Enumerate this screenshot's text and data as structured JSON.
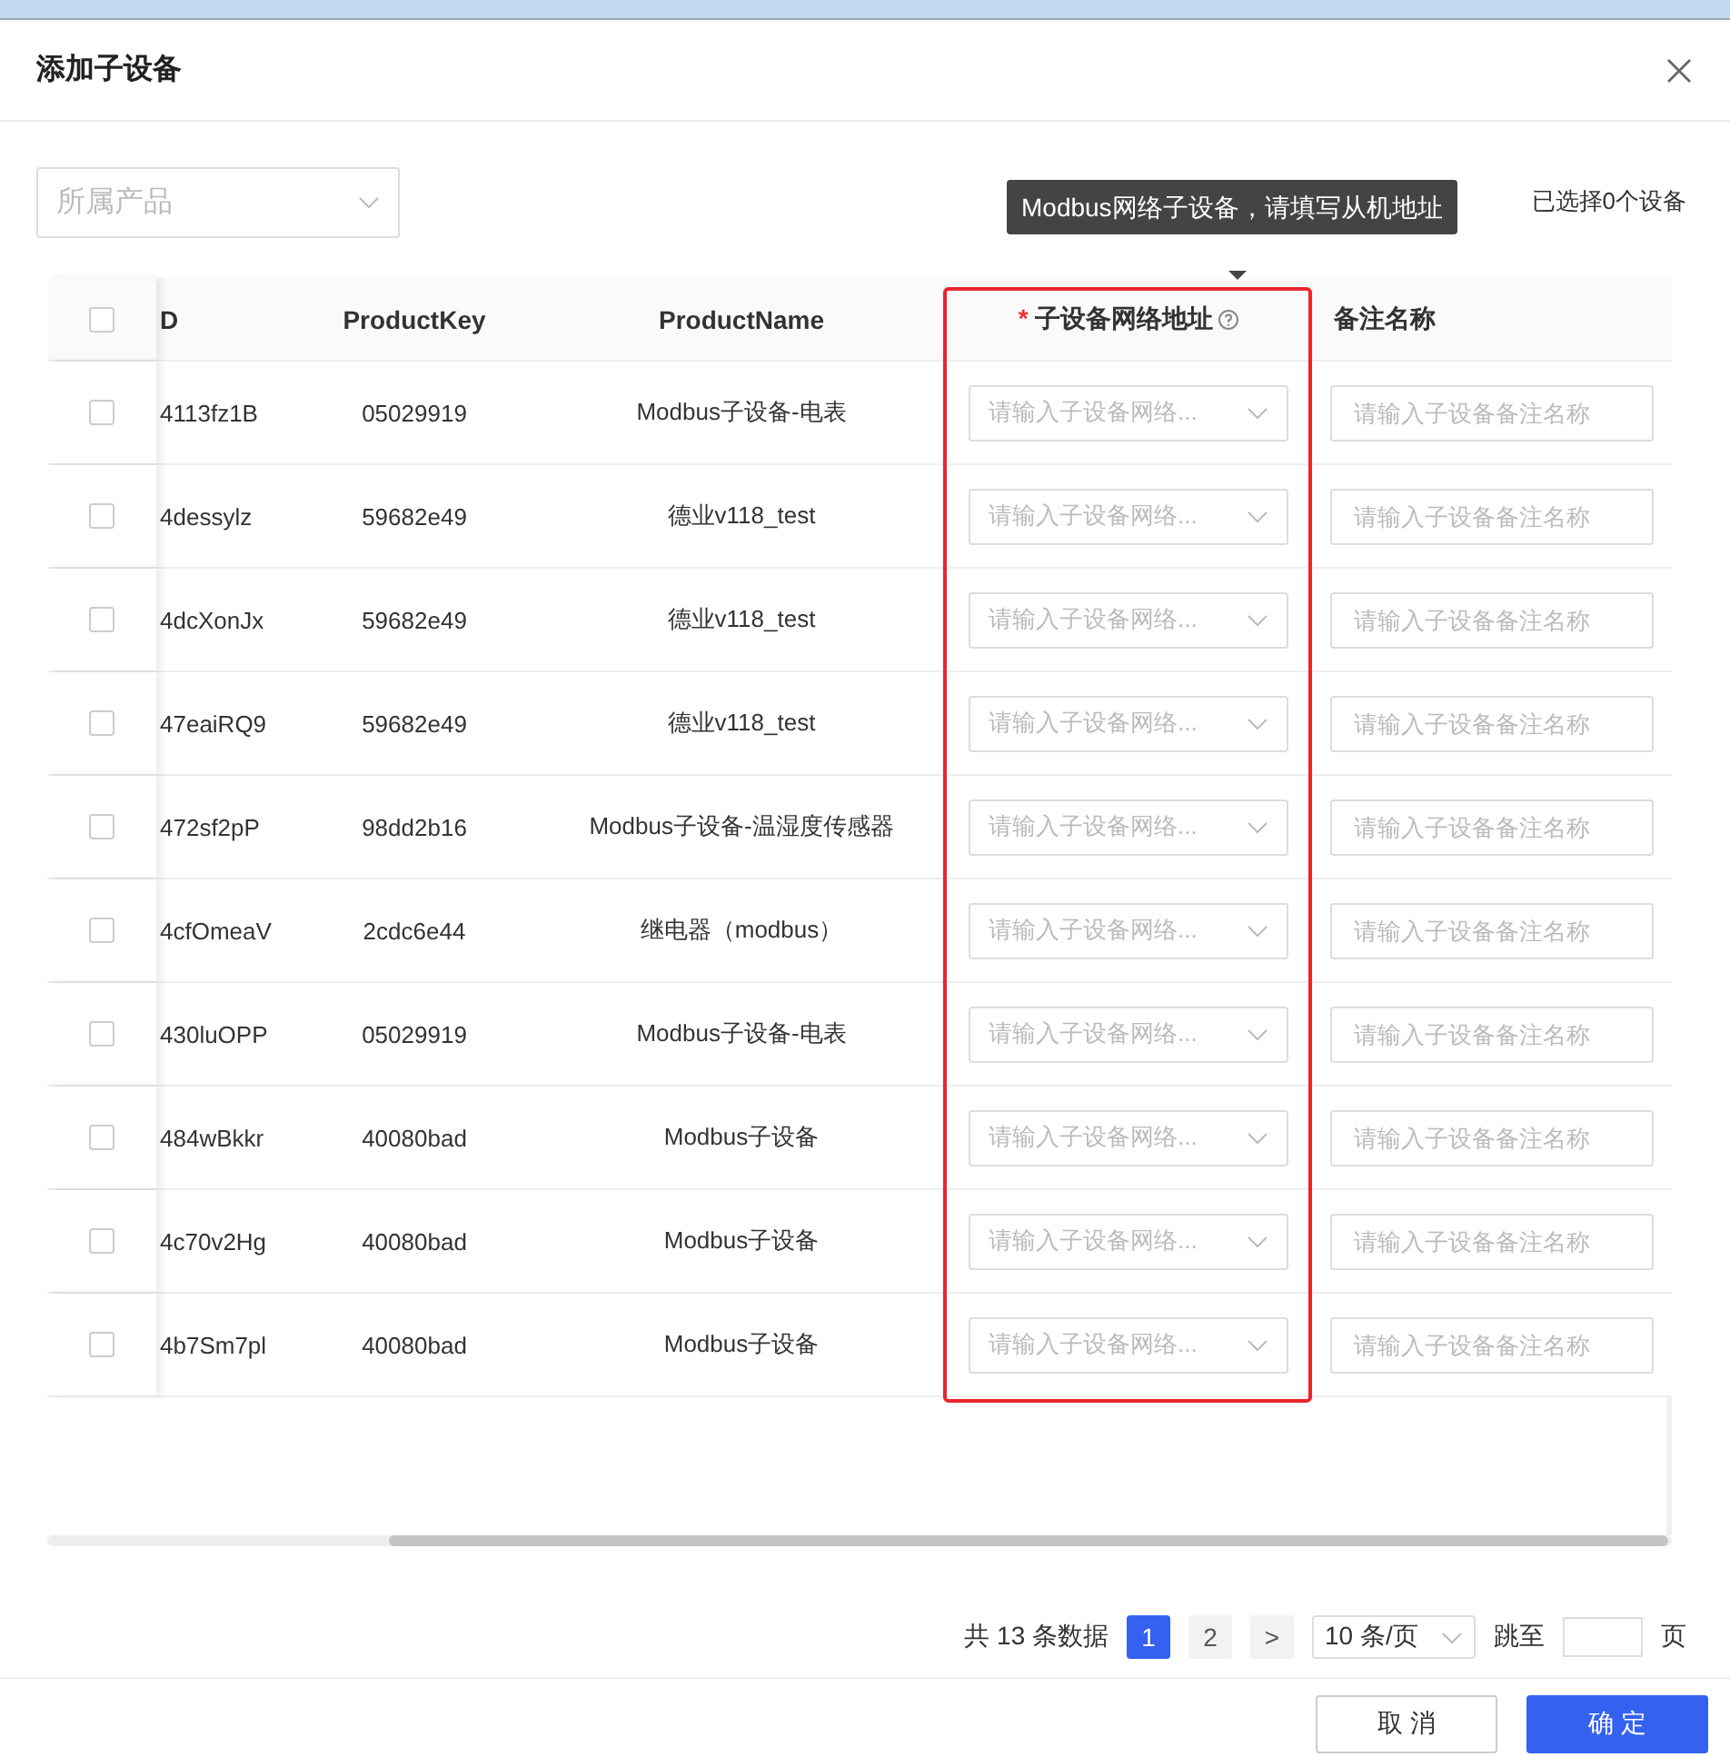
{
  "dialog": {
    "title": "添加子设备"
  },
  "filter": {
    "placeholder": "所属产品"
  },
  "selected_count": "已选择0个设备",
  "tooltip": "Modbus网络子设备，请填写从机地址",
  "table": {
    "columns": [
      {
        "label": "D",
        "kind": "text"
      },
      {
        "label": "ProductKey",
        "kind": "text"
      },
      {
        "label": "ProductName",
        "kind": "text"
      },
      {
        "label": "子设备网络地址",
        "kind": "address",
        "required_mark": "*"
      },
      {
        "label": "备注名称",
        "kind": "remark"
      }
    ],
    "header_checked": false,
    "rows": [
      {
        "checked": false,
        "id": "4113fz1B",
        "product_key": "05029919",
        "product_name": "Modbus子设备-电表",
        "address_placeholder": "请输入子设备网络...",
        "remark_placeholder": "请输入子设备备注名称"
      },
      {
        "checked": false,
        "id": "4dessylz",
        "product_key": "59682e49",
        "product_name": "德业v118_test",
        "address_placeholder": "请输入子设备网络...",
        "remark_placeholder": "请输入子设备备注名称"
      },
      {
        "checked": false,
        "id": "4dcXonJx",
        "product_key": "59682e49",
        "product_name": "德业v118_test",
        "address_placeholder": "请输入子设备网络...",
        "remark_placeholder": "请输入子设备备注名称"
      },
      {
        "checked": false,
        "id": "47eaiRQ9",
        "product_key": "59682e49",
        "product_name": "德业v118_test",
        "address_placeholder": "请输入子设备网络...",
        "remark_placeholder": "请输入子设备备注名称"
      },
      {
        "checked": false,
        "id": "472sf2pP",
        "product_key": "98dd2b16",
        "product_name": "Modbus子设备-温湿度传感器",
        "address_placeholder": "请输入子设备网络...",
        "remark_placeholder": "请输入子设备备注名称"
      },
      {
        "checked": false,
        "id": "4cfOmeaV",
        "product_key": "2cdc6e44",
        "product_name": "继电器（modbus）",
        "address_placeholder": "请输入子设备网络...",
        "remark_placeholder": "请输入子设备备注名称"
      },
      {
        "checked": false,
        "id": "430luOPP",
        "product_key": "05029919",
        "product_name": "Modbus子设备-电表",
        "address_placeholder": "请输入子设备网络...",
        "remark_placeholder": "请输入子设备备注名称"
      },
      {
        "checked": false,
        "id": "484wBkkr",
        "product_key": "40080bad",
        "product_name": "Modbus子设备",
        "address_placeholder": "请输入子设备网络...",
        "remark_placeholder": "请输入子设备备注名称"
      },
      {
        "checked": false,
        "id": "4c70v2Hg",
        "product_key": "40080bad",
        "product_name": "Modbus子设备",
        "address_placeholder": "请输入子设备网络...",
        "remark_placeholder": "请输入子设备备注名称"
      },
      {
        "checked": false,
        "id": "4b7Sm7pl",
        "product_key": "40080bad",
        "product_name": "Modbus子设备",
        "address_placeholder": "请输入子设备网络...",
        "remark_placeholder": "请输入子设备备注名称"
      }
    ]
  },
  "pagination": {
    "total": "共 13 条数据",
    "pages": [
      {
        "label": "1",
        "selected": true
      },
      {
        "label": "2",
        "selected": false
      }
    ],
    "next": ">",
    "page_size": "10 条/页",
    "jump_label": "跳至",
    "page_unit": "页"
  },
  "buttons": [
    {
      "label": "取 消",
      "kind": "secondary"
    },
    {
      "label": "确 定",
      "kind": "primary"
    }
  ]
}
